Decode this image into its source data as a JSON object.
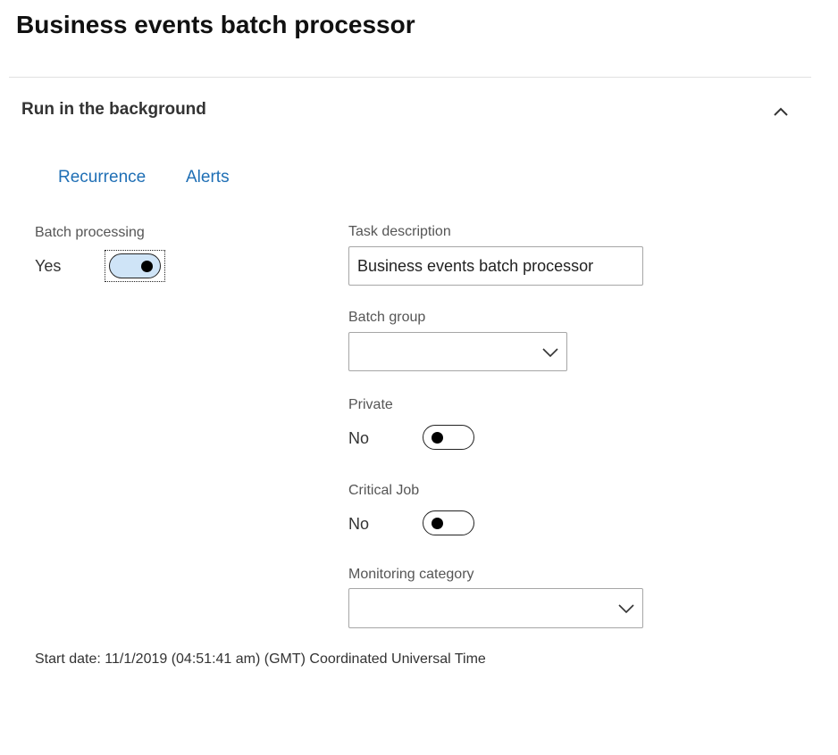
{
  "page": {
    "title": "Business events batch processor"
  },
  "section": {
    "title": "Run in the background",
    "expanded": true
  },
  "tabs": [
    {
      "label": "Recurrence"
    },
    {
      "label": "Alerts"
    }
  ],
  "batch_processing": {
    "label": "Batch processing",
    "value_text": "Yes",
    "on": true
  },
  "task_description": {
    "label": "Task description",
    "value": "Business events batch processor"
  },
  "batch_group": {
    "label": "Batch group",
    "value": ""
  },
  "private": {
    "label": "Private",
    "value_text": "No",
    "on": false
  },
  "critical_job": {
    "label": "Critical Job",
    "value_text": "No",
    "on": false
  },
  "monitoring_category": {
    "label": "Monitoring category",
    "value": ""
  },
  "footer": {
    "start_date": "Start date: 11/1/2019 (04:51:41 am) (GMT) Coordinated Universal Time"
  },
  "colors": {
    "link": "#1f6fb5",
    "toggle_on_fill": "#cfe4f7",
    "input_border": "#a6a6a6"
  },
  "icons": {
    "collapse": "chevron-up-icon",
    "dropdown": "chevron-down-icon"
  }
}
